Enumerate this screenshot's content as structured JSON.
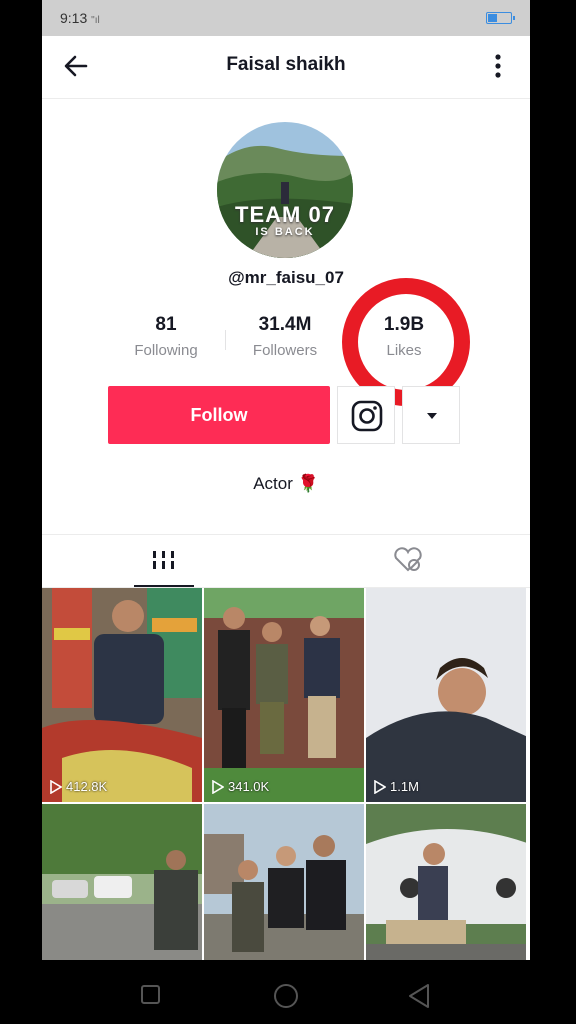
{
  "status_bar": {
    "time": "9:13",
    "signal": "\"ᴳᴵᴸ"
  },
  "header": {
    "title": "Faisal shaikh"
  },
  "profile": {
    "avatar_text": "TEAM 07",
    "avatar_subtext": "IS BACK",
    "username": "@mr_faisu_07",
    "stats": [
      {
        "value": "81",
        "label": "Following"
      },
      {
        "value": "31.4M",
        "label": "Followers"
      },
      {
        "value": "1.9B",
        "label": "Likes"
      }
    ],
    "follow_label": "Follow",
    "bio": "Actor 🌹"
  },
  "videos": [
    {
      "views": "412.8K"
    },
    {
      "views": "341.0K"
    },
    {
      "views": "1.1M"
    },
    {
      "views": ""
    },
    {
      "views": ""
    },
    {
      "views": ""
    }
  ],
  "colors": {
    "accent": "#fe2c55",
    "highlight_ring": "#e81b25"
  }
}
